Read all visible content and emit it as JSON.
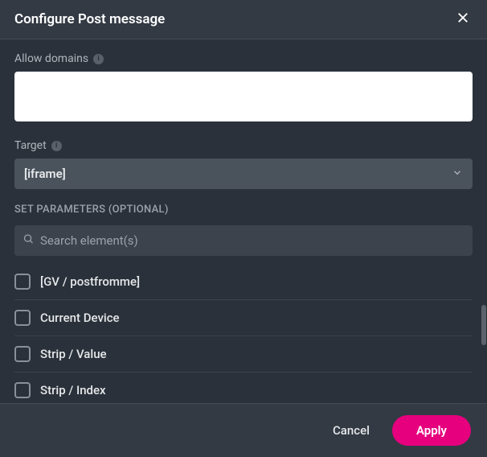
{
  "dialog": {
    "title": "Configure Post message"
  },
  "fields": {
    "allow_domains": {
      "label": "Allow domains",
      "value": ""
    },
    "target": {
      "label": "Target",
      "selected": "[iframe]"
    }
  },
  "parameters": {
    "section_label": "SET PARAMETERS (OPTIONAL)",
    "search": {
      "placeholder": "Search element(s)",
      "value": ""
    },
    "items": [
      {
        "label": "[GV / postfromme]",
        "checked": false
      },
      {
        "label": "Current Device",
        "checked": false
      },
      {
        "label": "Strip / Value",
        "checked": false
      },
      {
        "label": "Strip / Index",
        "checked": false
      }
    ]
  },
  "footer": {
    "cancel": "Cancel",
    "apply": "Apply"
  }
}
